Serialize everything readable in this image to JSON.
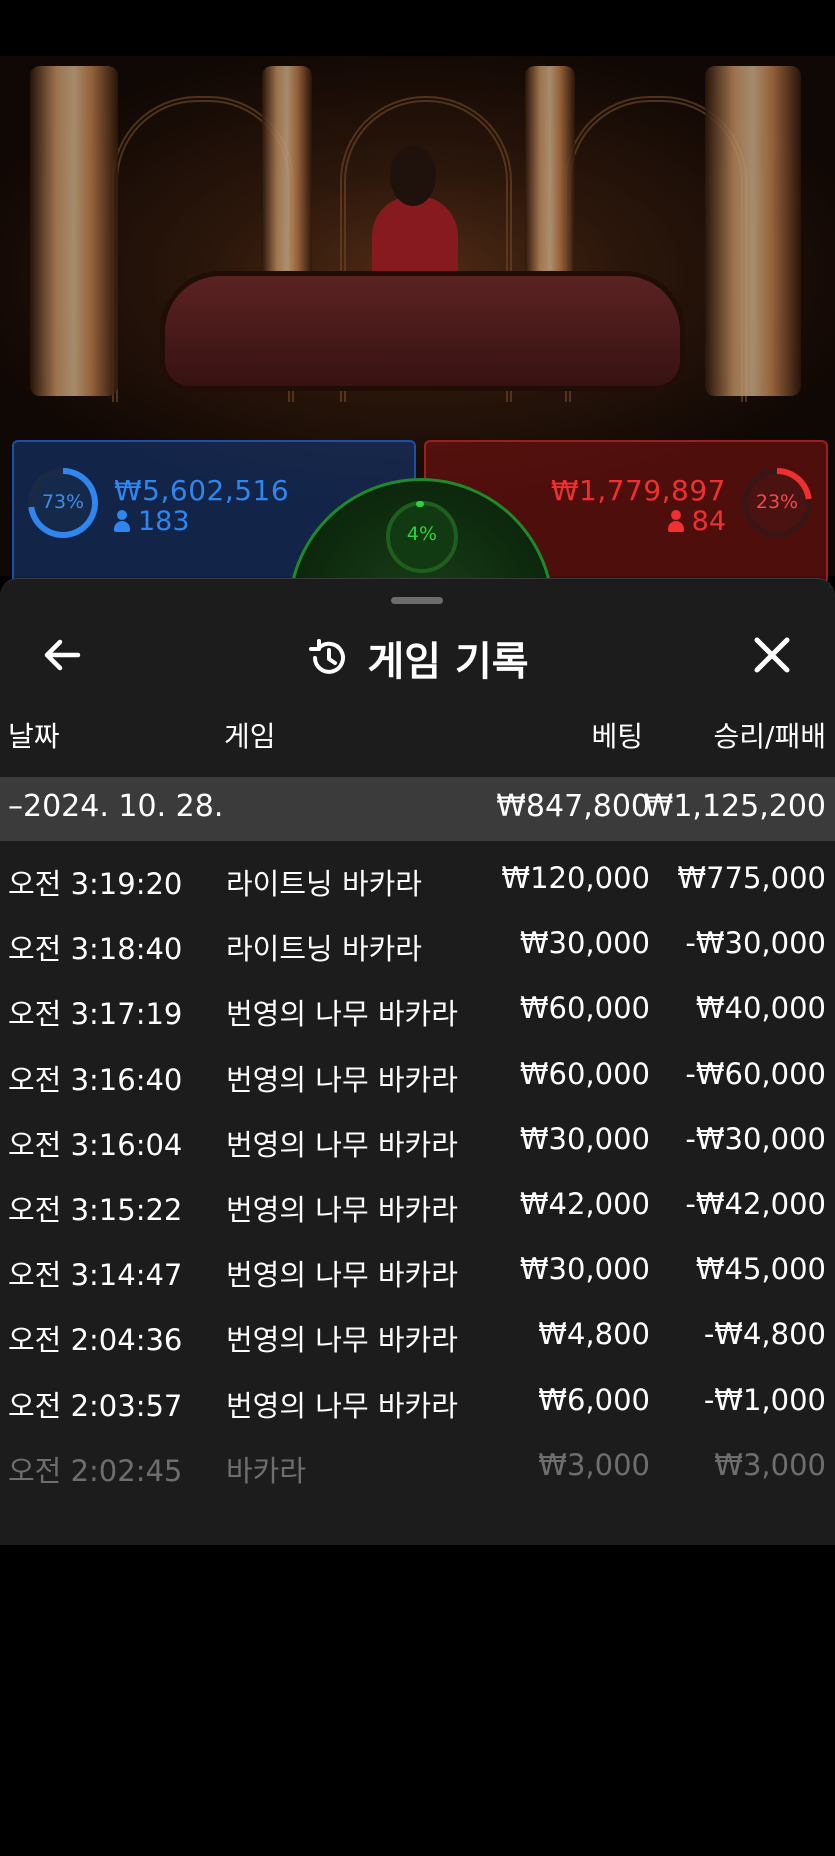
{
  "colors": {
    "player_blue": "#2f86ee",
    "banker_red": "#ee3030",
    "tie_green": "#2fd13f",
    "sheet_bg": "#1c1c1c",
    "date_row_bg": "#3b3b3b"
  },
  "bets": {
    "player": {
      "percent": "73%",
      "percent_value": 0.73,
      "amount": "₩5,602,516",
      "players": "183"
    },
    "tie": {
      "percent": "4%",
      "percent_value": 0.04
    },
    "banker": {
      "percent": "23%",
      "percent_value": 0.23,
      "amount": "₩1,779,897",
      "players": "84"
    }
  },
  "history": {
    "title": "게임 기록",
    "icons": {
      "back": "arrow-left-icon",
      "title": "history-icon",
      "close": "close-icon"
    },
    "columns": {
      "date": "날짜",
      "game": "게임",
      "bet": "베팅",
      "result": "승리/패배"
    },
    "date_group": {
      "date": "–2024. 10. 28.",
      "total_bet": "₩847,800",
      "total_result": "₩1,125,200"
    },
    "rows": [
      {
        "time": "오전 3:19:20",
        "game": "라이트닝 바카라",
        "bet": "₩120,000",
        "result": "₩775,000"
      },
      {
        "time": "오전 3:18:40",
        "game": "라이트닝 바카라",
        "bet": "₩30,000",
        "result": "-₩30,000"
      },
      {
        "time": "오전 3:17:19",
        "game": "번영의 나무 바카라",
        "bet": "₩60,000",
        "result": "₩40,000"
      },
      {
        "time": "오전 3:16:40",
        "game": "번영의 나무 바카라",
        "bet": "₩60,000",
        "result": "-₩60,000"
      },
      {
        "time": "오전 3:16:04",
        "game": "번영의 나무 바카라",
        "bet": "₩30,000",
        "result": "-₩30,000"
      },
      {
        "time": "오전 3:15:22",
        "game": "번영의 나무 바카라",
        "bet": "₩42,000",
        "result": "-₩42,000"
      },
      {
        "time": "오전 3:14:47",
        "game": "번영의 나무 바카라",
        "bet": "₩30,000",
        "result": "₩45,000"
      },
      {
        "time": "오전 2:04:36",
        "game": "번영의 나무 바카라",
        "bet": "₩4,800",
        "result": "-₩4,800"
      },
      {
        "time": "오전 2:03:57",
        "game": "번영의 나무 바카라",
        "bet": "₩6,000",
        "result": "-₩1,000"
      },
      {
        "time": "오전 2:02:45",
        "game": "바카라",
        "bet": "₩3,000",
        "result": "₩3,000"
      }
    ]
  }
}
